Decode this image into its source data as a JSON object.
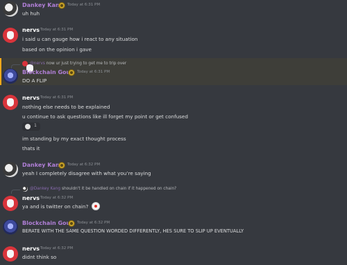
{
  "messages": [
    {
      "author": "Dankey Kang",
      "time": "Today at 6:31 PM",
      "lines": [
        "uh huh"
      ]
    },
    {
      "author": "nervs",
      "time": "Today at 6:31 PM",
      "lines": [
        "i said u can gauge how i react to any situation",
        "based on the opinion i gave"
      ]
    },
    {
      "author": "Blockchain GouL",
      "time": "Today at 6:31 PM",
      "reply": {
        "mention": "@nervs",
        "text": "now ur just trying to get me to trip over"
      },
      "lines": [
        "DO A FLIP"
      ]
    },
    {
      "author": "nervs",
      "time": "Today at 6:31 PM",
      "lines": [
        "nothing else needs to be explained",
        "u continue to ask questions like ill forget my point or get confused",
        "im standing by my exact thought process",
        "thats it"
      ],
      "reaction": {
        "count": "1"
      }
    },
    {
      "author": "Dankey Kang",
      "time": "Today at 6:32 PM",
      "lines": [
        "yeah I completely disagree with what you’re saying"
      ]
    },
    {
      "author": "nervs",
      "time": "Today at 6:32 PM",
      "reply": {
        "mention": "@Dankey Kang",
        "text": "shouldn't it be handled on chain if it happened on chain?"
      },
      "lines": [
        "ya and is twitter on chain?"
      ]
    },
    {
      "author": "Blockchain GouL",
      "time": "Today at 6:32 PM",
      "lines": [
        "BERATE WITH THE SAME QUESTION WORDED DIFFERENTLY, HES SURE TO SLIP UP EVENTUALLY"
      ]
    },
    {
      "author": "nervs",
      "time": "Today at 6:32 PM",
      "lines": [
        "didnt think so"
      ]
    }
  ]
}
